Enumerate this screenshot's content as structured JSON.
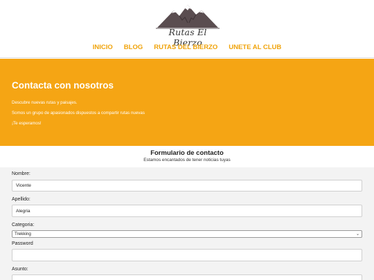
{
  "brand": {
    "logo_text": "Rutas El Bierzo"
  },
  "nav": {
    "items": [
      "INICIO",
      "BLOG",
      "RUTAS DEL BIERZO",
      "UNETE AL CLUB"
    ]
  },
  "hero": {
    "title": "Contacta con nosotros",
    "line1": "Descubre nuevas rutas y paisajes.",
    "line2": "Somos un grupo de apasionados dispuestos a compartir rutas nuevas",
    "line3": "¡Te esperamos!"
  },
  "form": {
    "title": "Formulario de contacto",
    "subtitle": "Estamos encantados de tener noticias tuyas",
    "nombre_label": "Nombre:",
    "nombre_value": "Vicente",
    "apellido_label": "Apellido:",
    "apellido_value": "Alegria",
    "categoria_label": "Categoria:",
    "categoria_value": "Trekking",
    "password_label": "Password",
    "password_value": "",
    "asunto_label": "Asunto:"
  },
  "colors": {
    "accent": "#f5a514",
    "nav_text": "#f0a30a"
  }
}
